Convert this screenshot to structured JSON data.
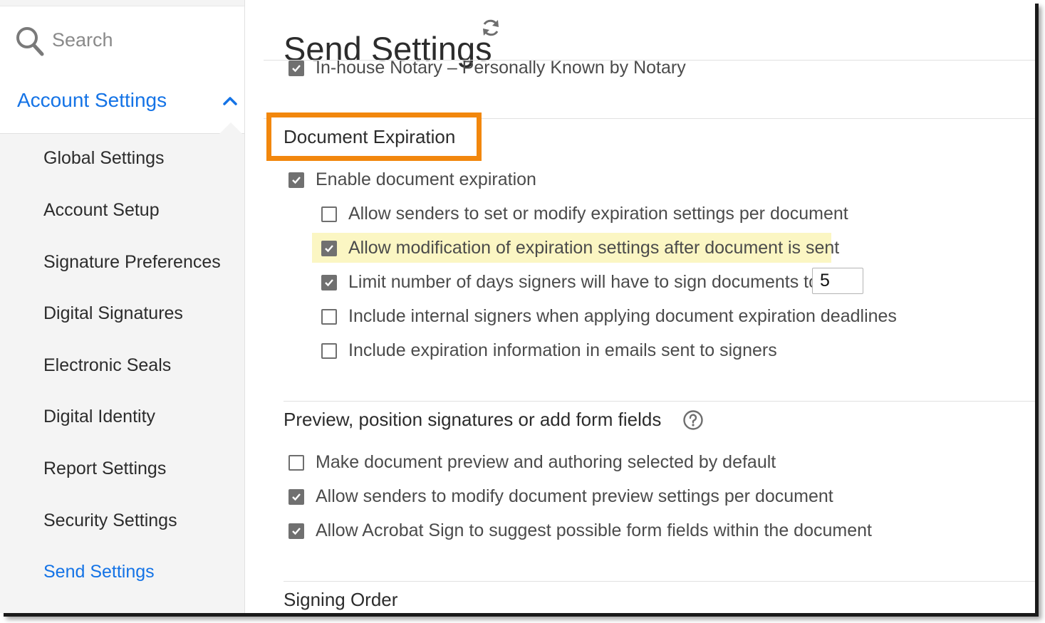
{
  "sidebar": {
    "search_placeholder": "Search",
    "account_settings_label": "Account Settings",
    "items": [
      {
        "label": "Global Settings"
      },
      {
        "label": "Account Setup"
      },
      {
        "label": "Signature Preferences"
      },
      {
        "label": "Digital Signatures"
      },
      {
        "label": "Electronic Seals"
      },
      {
        "label": "Digital Identity"
      },
      {
        "label": "Report Settings"
      },
      {
        "label": "Security Settings"
      },
      {
        "label": "Send Settings"
      }
    ],
    "active_item": "Send Settings"
  },
  "main": {
    "title": "Send Settings",
    "notary_option": {
      "label": "In-house Notary – Personally Known by Notary",
      "checked": true
    },
    "document_expiration": {
      "title": "Document Expiration",
      "enable": {
        "label": "Enable document expiration",
        "checked": true
      },
      "options": [
        {
          "label": "Allow senders to set or modify expiration settings per document",
          "checked": false
        },
        {
          "label": "Allow modification of expiration settings after document is sent",
          "checked": true,
          "highlighted": true
        },
        {
          "label": "Limit number of days signers will have to sign documents to:",
          "checked": true
        },
        {
          "label": "Include internal signers when applying document expiration deadlines",
          "checked": false
        },
        {
          "label": "Include expiration information in emails sent to signers",
          "checked": false
        }
      ],
      "days_value": "5"
    },
    "preview_section": {
      "title": "Preview, position signatures or add form fields",
      "options": [
        {
          "label": "Make document preview and authoring selected by default",
          "checked": false
        },
        {
          "label": "Allow senders to modify document preview settings per document",
          "checked": true
        },
        {
          "label": "Allow Acrobat Sign to suggest possible form fields within the document",
          "checked": true
        }
      ]
    },
    "signing_order": {
      "title": "Signing Order"
    }
  },
  "colors": {
    "accent": "#1473e6",
    "callout_border": "#f2870d",
    "highlight": "#fbf6c3",
    "checkbox_fill": "#707070"
  }
}
